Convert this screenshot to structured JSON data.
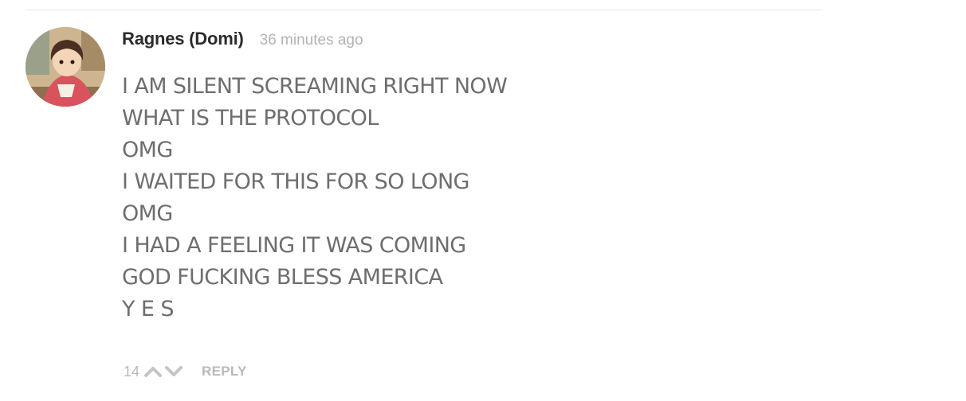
{
  "comment": {
    "author": "Ragnes (Domi)",
    "timestamp": "36 minutes ago",
    "avatar_icon": "user-avatar-anime-girl",
    "lines": [
      "I AM SILENT SCREAMING RIGHT NOW",
      "WHAT IS THE PROTOCOL",
      "OMG",
      "I WAITED FOR THIS FOR SO LONG",
      "OMG",
      "I HAD A FEELING IT WAS COMING",
      "GOD FUCKING BLESS AMERICA",
      "Y E S"
    ],
    "votes": "14",
    "reply_label": "REPLY"
  },
  "colors": {
    "author": "#2b2b2b",
    "timestamp": "#b3b3b3",
    "body_text": "#6e6e6e",
    "actions": "#b9b9b9",
    "divider": "#e6e6e6"
  },
  "icons": {
    "upvote": "chevron-up-icon",
    "downvote": "chevron-down-icon"
  }
}
